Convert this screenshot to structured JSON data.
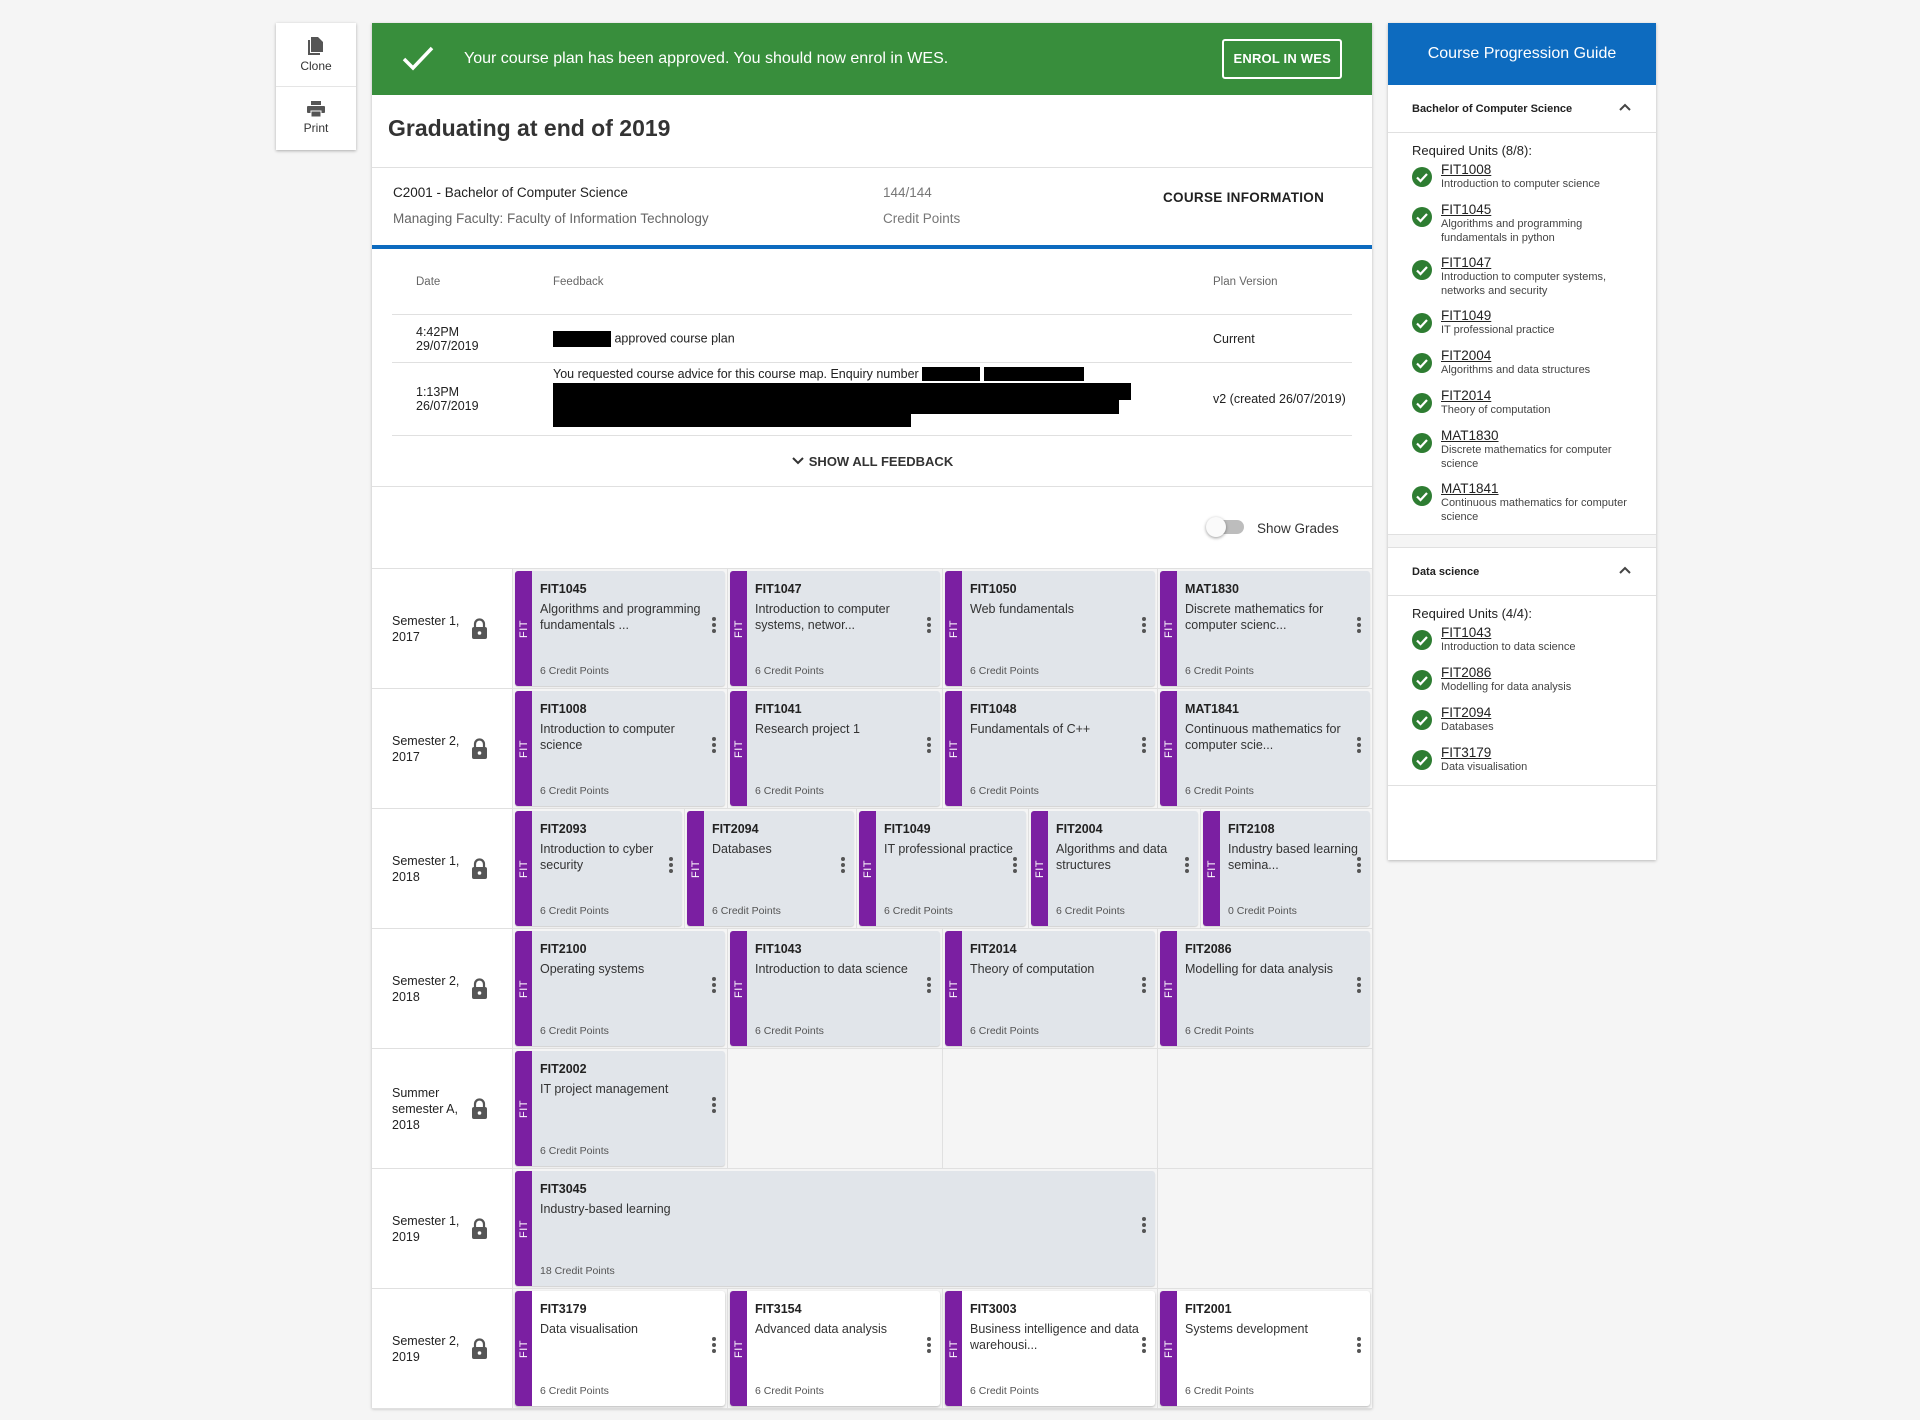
{
  "toolbar": {
    "clone": "Clone",
    "print": "Print"
  },
  "banner": {
    "message": "Your course plan has been approved. You should now enrol in WES.",
    "enrol": "ENROL IN WES"
  },
  "graduating": "Graduating at end of 2019",
  "course": {
    "title": "C2001 - Bachelor of Computer Science",
    "faculty": "Managing Faculty: Faculty of Information Technology",
    "credits": "144/144",
    "credits_label": "Credit Points",
    "info": "COURSE INFORMATION"
  },
  "feedback": {
    "headers": {
      "date": "Date",
      "feedback": "Feedback",
      "version": "Plan Version"
    },
    "rows": [
      {
        "time": "4:42PM",
        "date": "29/07/2019",
        "text_before": "",
        "text": "approved course plan",
        "version": "Current"
      },
      {
        "time": "1:13PM",
        "date": "26/07/2019",
        "text": "You requested course advice for this course map. Enquiry number",
        "version": "v2 (created 26/07/2019)"
      }
    ],
    "show_all": "SHOW ALL FEEDBACK"
  },
  "grades": {
    "label": "Show Grades"
  },
  "semesters": [
    {
      "label": "Semester 1, 2017",
      "slots": 4,
      "units": [
        {
          "code": "FIT1045",
          "name": "Algorithms and programming fundamentals ...",
          "cp": "6 Credit Points",
          "faculty": "FIT"
        },
        {
          "code": "FIT1047",
          "name": "Introduction to computer systems, networ...",
          "cp": "6 Credit Points",
          "faculty": "FIT"
        },
        {
          "code": "FIT1050",
          "name": "Web fundamentals",
          "cp": "6 Credit Points",
          "faculty": "FIT"
        },
        {
          "code": "MAT1830",
          "name": "Discrete mathematics for computer scienc...",
          "cp": "6 Credit Points",
          "faculty": "FIT"
        }
      ]
    },
    {
      "label": "Semester 2, 2017",
      "slots": 4,
      "units": [
        {
          "code": "FIT1008",
          "name": "Introduction to computer science",
          "cp": "6 Credit Points",
          "faculty": "FIT"
        },
        {
          "code": "FIT1041",
          "name": "Research project 1",
          "cp": "6 Credit Points",
          "faculty": "FIT"
        },
        {
          "code": "FIT1048",
          "name": "Fundamentals of C++",
          "cp": "6 Credit Points",
          "faculty": "FIT"
        },
        {
          "code": "MAT1841",
          "name": "Continuous mathematics for computer scie...",
          "cp": "6 Credit Points",
          "faculty": "FIT"
        }
      ]
    },
    {
      "label": "Semester 1, 2018",
      "slots": 5,
      "units": [
        {
          "code": "FIT2093",
          "name": "Introduction to cyber security",
          "cp": "6 Credit Points",
          "faculty": "FIT"
        },
        {
          "code": "FIT2094",
          "name": "Databases",
          "cp": "6 Credit Points",
          "faculty": "FIT"
        },
        {
          "code": "FIT1049",
          "name": "IT professional practice",
          "cp": "6 Credit Points",
          "faculty": "FIT"
        },
        {
          "code": "FIT2004",
          "name": "Algorithms and data structures",
          "cp": "6 Credit Points",
          "faculty": "FIT"
        },
        {
          "code": "FIT2108",
          "name": "Industry based learning semina...",
          "cp": "0 Credit Points",
          "faculty": "FIT"
        }
      ]
    },
    {
      "label": "Semester 2, 2018",
      "slots": 4,
      "units": [
        {
          "code": "FIT2100",
          "name": "Operating systems",
          "cp": "6 Credit Points",
          "faculty": "FIT"
        },
        {
          "code": "FIT1043",
          "name": "Introduction to data science",
          "cp": "6 Credit Points",
          "faculty": "FIT"
        },
        {
          "code": "FIT2014",
          "name": "Theory of computation",
          "cp": "6 Credit Points",
          "faculty": "FIT"
        },
        {
          "code": "FIT2086",
          "name": "Modelling for data analysis",
          "cp": "6 Credit Points",
          "faculty": "FIT"
        }
      ]
    },
    {
      "label": "Summer semester A, 2018",
      "slots": 4,
      "units": [
        {
          "code": "FIT2002",
          "name": "IT project management",
          "cp": "6 Credit Points",
          "faculty": "FIT"
        }
      ]
    },
    {
      "label": "Semester 1, 2019",
      "slots": 4,
      "units": [
        {
          "code": "FIT3045",
          "name": "Industry-based learning",
          "cp": "18 Credit Points",
          "faculty": "FIT",
          "span": 3
        }
      ]
    },
    {
      "label": "Semester 2, 2019",
      "slots": 4,
      "white": true,
      "units": [
        {
          "code": "FIT3179",
          "name": "Data visualisation",
          "cp": "6 Credit Points",
          "faculty": "FIT"
        },
        {
          "code": "FIT3154",
          "name": "Advanced data analysis",
          "cp": "6 Credit Points",
          "faculty": "FIT"
        },
        {
          "code": "FIT3003",
          "name": "Business intelligence and data warehousi...",
          "cp": "6 Credit Points",
          "faculty": "FIT"
        },
        {
          "code": "FIT2001",
          "name": "Systems development",
          "cp": "6 Credit Points",
          "faculty": "FIT"
        }
      ]
    }
  ],
  "guide": {
    "title": "Course Progression Guide",
    "sections": [
      {
        "name": "Bachelor of Computer Science",
        "required": "Required Units (8/8):",
        "units": [
          {
            "code": "FIT1008",
            "name": "Introduction to computer science"
          },
          {
            "code": "FIT1045",
            "name": "Algorithms and programming fundamentals in python"
          },
          {
            "code": "FIT1047",
            "name": "Introduction to computer systems, networks and security"
          },
          {
            "code": "FIT1049",
            "name": "IT professional practice"
          },
          {
            "code": "FIT2004",
            "name": "Algorithms and data structures"
          },
          {
            "code": "FIT2014",
            "name": "Theory of computation"
          },
          {
            "code": "MAT1830",
            "name": "Discrete mathematics for computer science"
          },
          {
            "code": "MAT1841",
            "name": "Continuous mathematics for computer science"
          }
        ]
      },
      {
        "name": "Data science",
        "required": "Required Units (4/4):",
        "units": [
          {
            "code": "FIT1043",
            "name": "Introduction to data science"
          },
          {
            "code": "FIT2086",
            "name": "Modelling for data analysis"
          },
          {
            "code": "FIT2094",
            "name": "Databases"
          },
          {
            "code": "FIT3179",
            "name": "Data visualisation"
          }
        ]
      }
    ]
  },
  "colors": {
    "banner": "#388e3c",
    "accent": "#0d6bbf",
    "faculty": "#7b1fa2",
    "check": "#2e7d32"
  }
}
